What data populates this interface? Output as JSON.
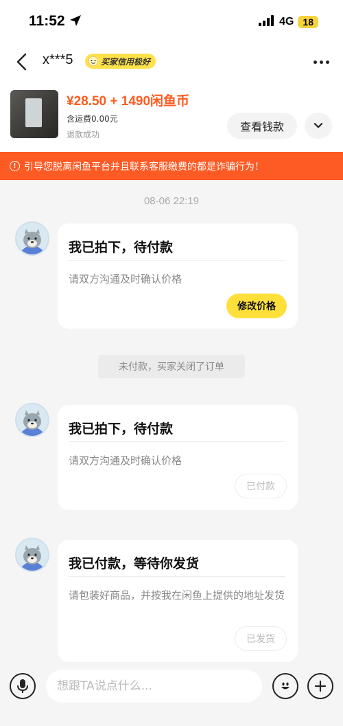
{
  "status_bar": {
    "time": "11:52",
    "network": "4G",
    "battery": "18"
  },
  "header": {
    "username": "x***5",
    "badge": "买家信用极好"
  },
  "product": {
    "price": "¥28.50 + 1490闲鱼币",
    "shipping": "含运费0.00元",
    "status": "退款成功",
    "wallet_button": "查看钱款"
  },
  "warning": "引导您脱离闲鱼平台并且联系客服缴费的都是诈骗行为！",
  "chat": {
    "timestamp": "08-06 22:19",
    "messages": [
      {
        "title": "我已拍下，待付款",
        "desc": "请双方沟通及时确认价格",
        "button": "修改价格"
      },
      {
        "title": "我已拍下，待付款",
        "desc": "请双方沟通及时确认价格",
        "button": "已付款"
      },
      {
        "title": "我已付款，等待你发货",
        "desc": "请包装好商品，并按我在闲鱼上提供的地址发货",
        "button": "已发货"
      }
    ],
    "system_message": "未付款，买家关闭了订单"
  },
  "input": {
    "placeholder": "想跟TA说点什么..."
  },
  "colors": {
    "accent_yellow": "#ffe03b",
    "warning_orange": "#fe5a24",
    "price_orange": "#ff5a1f"
  }
}
